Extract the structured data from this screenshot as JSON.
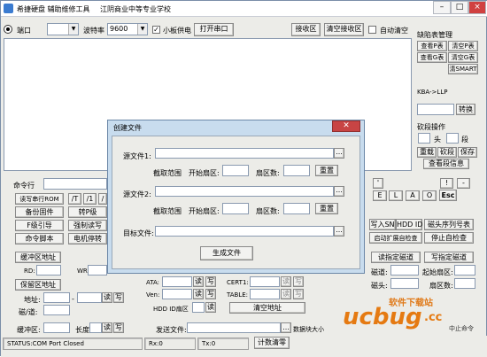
{
  "title": {
    "app": "希捷硬盘 辅助维修工具",
    "school": "江阴商业中等专业学校"
  },
  "toolbar": {
    "port_label": "端口",
    "baud_label": "波特率",
    "baud_value": "9600",
    "board_label": "小板供电",
    "open_port": "打开串口",
    "receive_area": "接收区",
    "clear_receive": "清空接收区",
    "auto_clear": "自动清空"
  },
  "log_area": {
    "title": "缺陷表管理",
    "btn1": "查看P表",
    "btn2": "清空P表",
    "btn3": "查看G表",
    "btn4": "清空G表",
    "btn5": "清SMART",
    "kba": "KBA->LLP",
    "convert": "转换",
    "section_title": "砍段操作",
    "head_label": "头",
    "seg_label": "段",
    "rebuild": "重载",
    "cut": "砍段",
    "save": "保存",
    "view_seg": "查看段信息"
  },
  "left_panel": {
    "cmd_label": "命令行",
    "b1": "读写串行ROM",
    "b2": "/T",
    "b3": "/1",
    "b4": "/",
    "b5": "备份固件",
    "b6": "转P级",
    "b7": "F级引导",
    "b8": "强制读写",
    "b9": "命令脚本",
    "b10": "电机停转",
    "buf_addr": "缓冲区地址",
    "rd": "RD:",
    "wr": "WR:",
    "save_area": "保留区地址",
    "addr": "地址:",
    "dash": "-",
    "read": "读",
    "write": "写",
    "head_seg": "磁/道:",
    "buf": "缓冲区:",
    "len": "长度:"
  },
  "mid_panel": {
    "ata": "ATA:",
    "cert": "CERT1:",
    "ven": "Ven:",
    "table": "TABLE:",
    "hdd_id": "HDD ID扇区",
    "clear_addr": "清空地址",
    "send_file": "发送文件:",
    "data_block": "数据块大小"
  },
  "right_panel": {
    "keys": [
      "'",
      "!",
      "-",
      "E",
      "L",
      "A",
      "O",
      "Esc"
    ],
    "write_sn": "写入SN",
    "hdd_id": "HDD ID",
    "head_map": "磁头序列号表",
    "auto_ext": "启动扩展自检查",
    "stop_check": "停止自检查",
    "read_track": "读指定磁道",
    "write_track": "写指定磁道",
    "track_label": "磁道:",
    "start_sector": "起始扇区:",
    "head_label": "磁头:",
    "sector_count": "扇区数:"
  },
  "dialog": {
    "title": "创建文件",
    "src1": "源文件1:",
    "src2": "源文件2:",
    "range": "截取范围",
    "start_sector": "开始扇区:",
    "sector_count": "扇区数:",
    "reset": "重置",
    "target": "目标文件:",
    "generate": "生成文件",
    "browse": "..."
  },
  "status": {
    "port": "STATUS:COM Port Closed",
    "rx": "Rx:0",
    "tx": "Tx:0",
    "clear_count": "计数清零"
  },
  "watermark": {
    "brand": "ucbug",
    "domain": ".cc",
    "subtitle": "软件下载站",
    "tag": "中止命令"
  }
}
